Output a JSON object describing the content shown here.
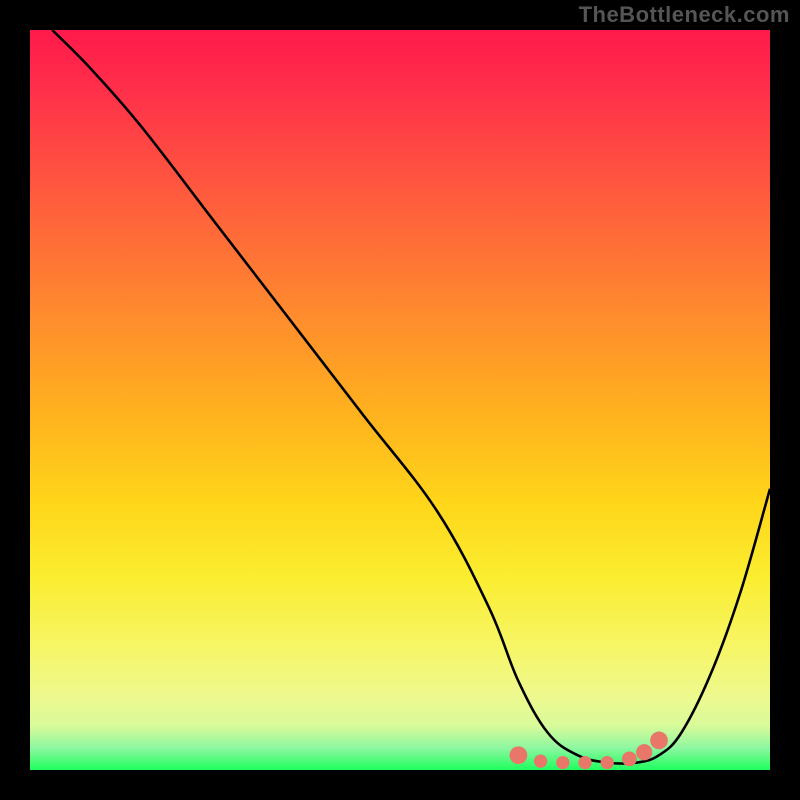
{
  "watermark": "TheBottleneck.com",
  "chart_data": {
    "type": "line",
    "title": "",
    "xlabel": "",
    "ylabel": "",
    "xlim": [
      0,
      100
    ],
    "ylim": [
      0,
      100
    ],
    "grid": false,
    "legend": false,
    "series": [
      {
        "name": "bottleneck-curve",
        "color": "#000000",
        "x": [
          3,
          8,
          15,
          25,
          35,
          45,
          55,
          62,
          66,
          70,
          74,
          78,
          82,
          85,
          88,
          92,
          96,
          100
        ],
        "y": [
          100,
          95,
          87,
          74,
          61,
          48,
          35,
          22,
          12,
          5,
          2,
          1,
          1,
          2,
          5,
          13,
          24,
          38
        ]
      }
    ],
    "markers": [
      {
        "name": "flat-region-left-cap",
        "x": 66,
        "y": 2,
        "r": 1.2,
        "color": "#e8776a"
      },
      {
        "name": "flat-region-dot-1",
        "x": 69,
        "y": 1.2,
        "r": 0.9,
        "color": "#e8776a"
      },
      {
        "name": "flat-region-dot-2",
        "x": 72,
        "y": 1.0,
        "r": 0.9,
        "color": "#e8776a"
      },
      {
        "name": "flat-region-dot-3",
        "x": 75,
        "y": 1.0,
        "r": 0.9,
        "color": "#e8776a"
      },
      {
        "name": "flat-region-dot-4",
        "x": 78,
        "y": 1.0,
        "r": 0.9,
        "color": "#e8776a"
      },
      {
        "name": "flat-region-right-1",
        "x": 81,
        "y": 1.5,
        "r": 1.0,
        "color": "#e8776a"
      },
      {
        "name": "flat-region-right-2",
        "x": 83,
        "y": 2.4,
        "r": 1.1,
        "color": "#e8776a"
      },
      {
        "name": "flat-region-right-cap",
        "x": 85,
        "y": 4.0,
        "r": 1.2,
        "color": "#e8776a"
      }
    ],
    "gradient_stops": [
      {
        "pos": 0,
        "color": "#ff1a4b"
      },
      {
        "pos": 22,
        "color": "#ff5a3e"
      },
      {
        "pos": 52,
        "color": "#ffb21e"
      },
      {
        "pos": 74,
        "color": "#fbed30"
      },
      {
        "pos": 94,
        "color": "#d9fb9a"
      },
      {
        "pos": 100,
        "color": "#1eff5e"
      }
    ]
  }
}
